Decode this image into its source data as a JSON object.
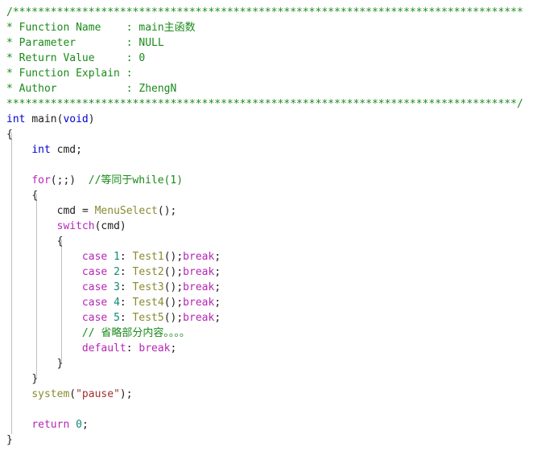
{
  "editor": {
    "language": "c",
    "background": "#ffffff",
    "font_size_px": 13,
    "line_height_px": 19,
    "indent_guide_color": "#bfbfbf",
    "colors": {
      "comment": "#1a8a1a",
      "type_keyword": "#0000d0",
      "control_keyword": "#b526b5",
      "function_name": "#8a8a32",
      "string": "#a03030",
      "number": "#0f8a7a",
      "plain": "#202020"
    }
  },
  "header_comment": {
    "rule_top": "/*********************************************************************************",
    "rule_bottom": "*********************************************************************************/",
    "fields": [
      {
        "star": "*",
        "label": "Function Name",
        "sep": ":",
        "value": "main主函数"
      },
      {
        "star": "*",
        "label": "Parameter",
        "sep": ":",
        "value": "NULL"
      },
      {
        "star": "*",
        "label": "Return Value",
        "sep": ":",
        "value": "0"
      },
      {
        "star": "*",
        "label": "Function Explain",
        "sep": ":",
        "value": ""
      },
      {
        "star": "*",
        "label": "Author",
        "sep": ":",
        "value": "ZhengN"
      }
    ]
  },
  "code": {
    "signature": {
      "type": "int",
      "name": "main",
      "paren_open": "(",
      "param_type": "void",
      "paren_close": ")"
    },
    "brace_open": "{",
    "brace_close": "}",
    "declaration": {
      "type": "int",
      "name": "cmd",
      "semi": ";"
    },
    "loop": {
      "keyword": "for",
      "clause": "(;;)",
      "comment": "//等同于while(1)",
      "brace_open": "{",
      "brace_close": "}"
    },
    "assign": {
      "lhs": "cmd",
      "op": "=",
      "callee": "MenuSelect",
      "args": "();"
    },
    "switch": {
      "keyword": "switch",
      "paren_open": "(",
      "expr": "cmd",
      "paren_close": ")",
      "brace_open": "{",
      "brace_close": "}",
      "cases": [
        {
          "keyword": "case",
          "value": "1",
          "colon": ":",
          "callee": "Test1",
          "call": "();",
          "break": "break",
          "semi": ";"
        },
        {
          "keyword": "case",
          "value": "2",
          "colon": ":",
          "callee": "Test2",
          "call": "();",
          "break": "break",
          "semi": ";"
        },
        {
          "keyword": "case",
          "value": "3",
          "colon": ":",
          "callee": "Test3",
          "call": "();",
          "break": "break",
          "semi": ";"
        },
        {
          "keyword": "case",
          "value": "4",
          "colon": ":",
          "callee": "Test4",
          "call": "();",
          "break": "break",
          "semi": ";"
        },
        {
          "keyword": "case",
          "value": "5",
          "colon": ":",
          "callee": "Test5",
          "call": "();",
          "break": "break",
          "semi": ";"
        }
      ],
      "omitted_comment": "// 省略部分内容。。。。",
      "default_case": {
        "keyword": "default",
        "colon": ":",
        "break": "break",
        "semi": ";"
      }
    },
    "system_call": {
      "callee": "system",
      "paren_open": "(",
      "arg": "\"pause\"",
      "tail": ");"
    },
    "return_stmt": {
      "keyword": "return",
      "value": "0",
      "semi": ";"
    }
  }
}
